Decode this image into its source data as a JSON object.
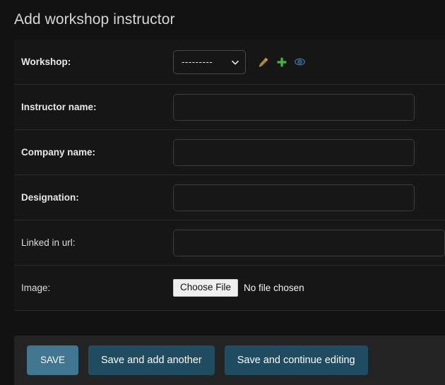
{
  "page": {
    "title": "Add workshop instructor",
    "background": "#121212",
    "accent": "#417690",
    "accent_alt": "#1f4c60"
  },
  "form": {
    "rows": [
      {
        "label": "Workshop:",
        "required": true,
        "widget": "select",
        "value": "---------",
        "related_icons": [
          {
            "name": "change-related-icon",
            "title": "Change selected workshop",
            "color": "#b08a2e"
          },
          {
            "name": "add-related-icon",
            "title": "Add another workshop",
            "color": "#44b33f"
          },
          {
            "name": "view-related-icon",
            "title": "View selected workshop",
            "color": "#2b5f8c"
          }
        ]
      },
      {
        "label": "Instructor name:",
        "required": true,
        "widget": "text",
        "value": "",
        "placeholder": ""
      },
      {
        "label": "Company name:",
        "required": true,
        "widget": "text",
        "value": "",
        "placeholder": ""
      },
      {
        "label": "Designation:",
        "required": true,
        "widget": "text",
        "value": "",
        "placeholder": ""
      },
      {
        "label": "Linked in url:",
        "required": false,
        "widget": "text-wide",
        "value": "",
        "placeholder": ""
      },
      {
        "label": "Image:",
        "required": false,
        "widget": "file",
        "button_label": "Choose File",
        "file_status": "No file chosen"
      }
    ]
  },
  "submit_row": {
    "save_label": "SAVE",
    "save_add_another_label": "Save and add another",
    "save_continue_label": "Save and continue editing"
  }
}
